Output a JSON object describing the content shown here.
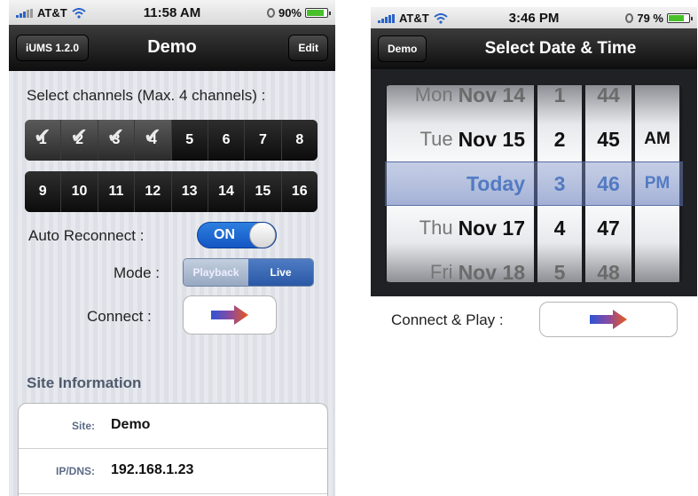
{
  "left": {
    "status": {
      "carrier": "AT&T",
      "time": "11:58 AM",
      "battery": "90%",
      "battery_level": 0.9
    },
    "nav": {
      "back_label": "iUMS 1.2.0",
      "title": "Demo",
      "edit_label": "Edit"
    },
    "channels": {
      "label": "Select channels (Max. 4 channels) :",
      "row1": [
        "1",
        "2",
        "3",
        "4",
        "5",
        "6",
        "7",
        "8"
      ],
      "row2": [
        "9",
        "10",
        "11",
        "12",
        "13",
        "14",
        "15",
        "16"
      ],
      "selected": [
        "1",
        "2",
        "3",
        "4"
      ]
    },
    "auto_reconnect": {
      "label": "Auto Reconnect :",
      "state": "ON"
    },
    "mode": {
      "label": "Mode :",
      "options": [
        "Playback",
        "Live"
      ],
      "selected": "Live"
    },
    "connect": {
      "label": "Connect :"
    },
    "site_info": {
      "header": "Site Information",
      "rows": [
        {
          "key": "Site:",
          "value": "Demo"
        },
        {
          "key": "IP/DNS:",
          "value": "192.168.1.23"
        }
      ]
    }
  },
  "right": {
    "status": {
      "carrier": "AT&T",
      "time": "3:46 PM",
      "battery": "79 %",
      "battery_level": 0.79
    },
    "nav": {
      "back_label": "Demo",
      "title": "Select Date & Time"
    },
    "picker": {
      "dates": [
        {
          "dow": "Mon",
          "date": "Nov 14"
        },
        {
          "dow": "Tue",
          "date": "Nov 15"
        },
        {
          "dow": "",
          "date": "Today"
        },
        {
          "dow": "Thu",
          "date": "Nov 17"
        },
        {
          "dow": "Fri",
          "date": "Nov 18"
        }
      ],
      "hours": [
        "1",
        "2",
        "3",
        "4",
        "5"
      ],
      "minutes": [
        "44",
        "45",
        "46",
        "47",
        "48"
      ],
      "ampm": [
        "",
        "AM",
        "PM",
        "",
        ""
      ],
      "selected_index": 2
    },
    "connect_play": {
      "label": "Connect & Play :"
    }
  },
  "colors": {
    "accent": "#2d7fe0",
    "nav_bg": "#111111",
    "arrow_start": "#2e54d6",
    "arrow_end": "#e85a1c"
  }
}
